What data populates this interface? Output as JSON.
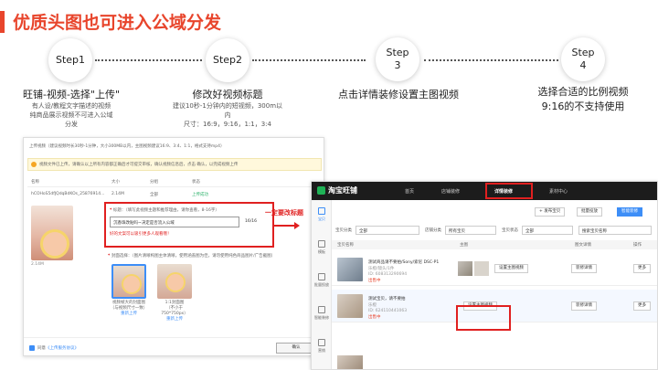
{
  "title": "优质头图也可进入公域分发",
  "steps": [
    {
      "bubble": [
        "Step1"
      ],
      "head": "旺铺-视频-选择\"上传\"",
      "desc": [
        "有人设/教程文字描述的视频",
        "纯商品展示视频不可进入公域",
        "分发"
      ]
    },
    {
      "bubble": [
        "Step2"
      ],
      "head": "修改好视频标题",
      "desc": [
        "建议10秒-1分钟内的短视频，300m以内",
        "尺寸：16:9，9:16，1:1，3:4"
      ]
    },
    {
      "bubble": [
        "Step",
        "3"
      ],
      "head": "点击详情装修设置主图视频",
      "desc": []
    },
    {
      "bubble": [
        "Step",
        "4"
      ],
      "head": "选择合适的比例视频",
      "desc": [
        "9:16的不支持使用"
      ]
    }
  ],
  "upload_dialog": {
    "rule_text": "上传视频（建议视频时长30秒-1分钟，大小300MB以内，主图视频建议16:9、3:4、1:1，格式支持mp4）",
    "warning": "视频文件已上传，请确认以上所有内容都正确后才可提交审核，确认视频信息后，点击 确认，以完成视频上传",
    "columns": [
      "名称",
      "大小",
      "分组",
      "状态"
    ],
    "file": {
      "name": "hCOHoS5dfJQdqBdKOs_25876914...",
      "size": "2.14M",
      "group": "全部",
      "status": "上传成功"
    },
    "thumb_label": "2.14M",
    "title_label": "标题：",
    "title_hint": "（填写此视频主题和推荐理由，请你查看，8-16字）",
    "title_value": "沉香珠改贴吗~决定是否流入公域",
    "title_count": "16/16",
    "title_tip": "好的文案可以吸引更多人观看哦！",
    "arrow_text": "一定要改标题",
    "cover_label": "封面选择：（图片清晰构图主体清晰，使用涵盖图为佳，请勿使用纯色商品图片/广告截图）",
    "covers": [
      {
        "caption": [
          "视频帧大的封面图",
          "（与视频尺寸一致）",
          "重新上传"
        ]
      },
      {
        "caption": [
          "1:1封面图",
          "（不小于750*750px）",
          "重新上传"
        ]
      }
    ],
    "agree_prefix": "同意",
    "agree_link": "《上传服务协议》",
    "confirm": "确认"
  },
  "shop_panel": {
    "logo": "淘宝旺铺",
    "nav": [
      "首页",
      "店铺装修",
      "详情装修",
      "素材中心"
    ],
    "side": [
      "宝贝",
      "模板",
      "批量投放",
      "智能装修",
      "营销"
    ],
    "actions": [
      "+ 发布宝贝",
      "批量投放",
      "智能装修"
    ],
    "filters": {
      "category_label": "宝贝分类",
      "category_value": "全部",
      "group_label": "店铺分类",
      "group_value": "所有宝贝",
      "status_label": "宝贝状态",
      "status_value": "全部",
      "search_placeholder": "搜索宝贝名称"
    },
    "columns": [
      "宝贝名称",
      "主图",
      "图文详情",
      "操作"
    ],
    "rows": [
      {
        "name": "测试商品请不要拍/Sony/索尼 DSC-P1",
        "sub1": "乐橙/镜头/1件",
        "sub2": "ID: 608313290694",
        "status": "出售中",
        "set": "设置主图视频",
        "detail": "装修详情",
        "more": "更多"
      },
      {
        "name": "测试宝贝，请不要拍",
        "sub1": "乐橙",
        "sub2": "ID: 624110441063",
        "status": "出售中",
        "set": "设置主图视频",
        "detail": "装修详情",
        "more": "更多"
      }
    ]
  }
}
